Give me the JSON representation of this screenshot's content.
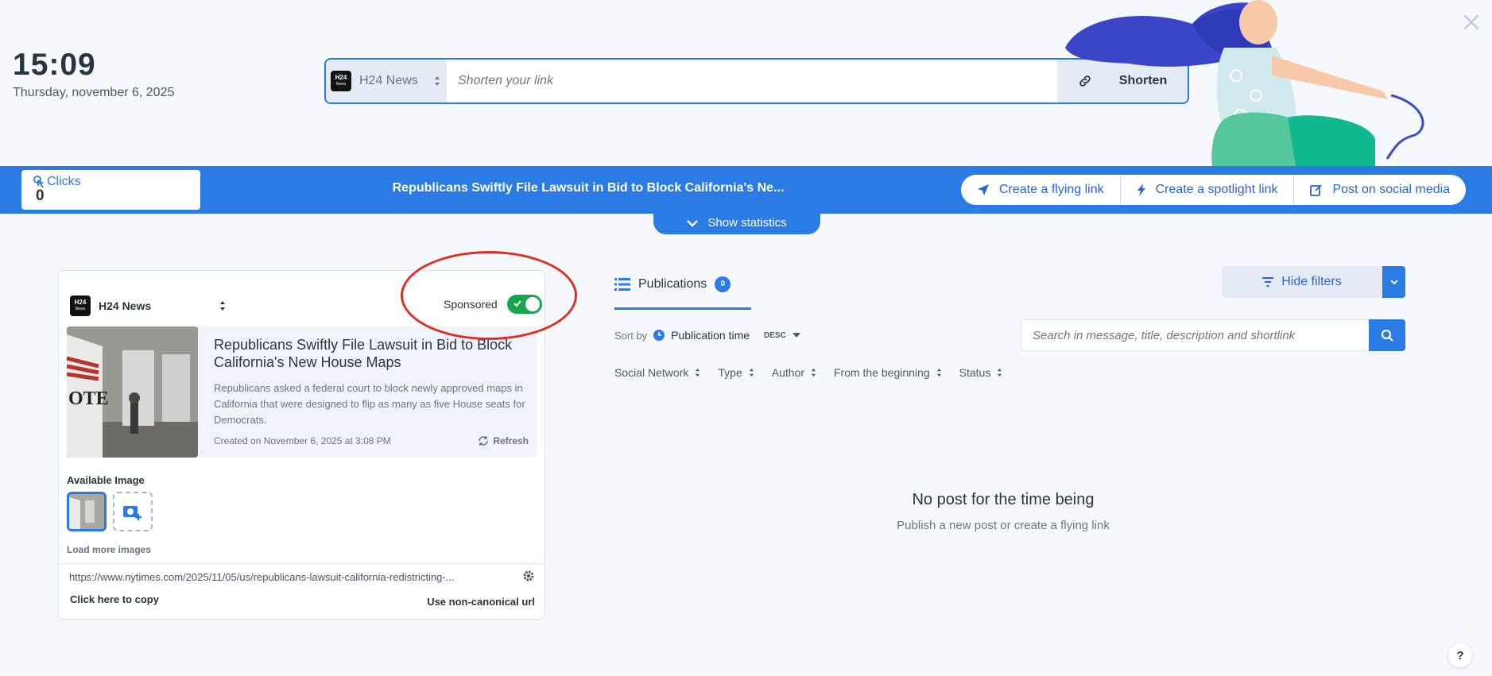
{
  "clock": {
    "time": "15:09",
    "date": "Thursday, november 6, 2025"
  },
  "shortener": {
    "brand": "H24 News",
    "placeholder": "Shorten your link",
    "button": "Shorten"
  },
  "logo": {
    "top": "H24",
    "bottom": "News"
  },
  "bar": {
    "clicks_label": "Clicks",
    "clicks_value": "0",
    "title": "Republicans Swiftly File Lawsuit in Bid to Block California's Ne...",
    "actions": [
      "Create a flying link",
      "Create a spotlight link",
      "Post on social media"
    ],
    "stats_label": "Show statistics"
  },
  "card": {
    "brand": "H24 News",
    "sponsored_label": "Sponsored",
    "sponsored_on": true,
    "preview_title": "Republicans Swiftly File Lawsuit in Bid to Block California's New House Maps",
    "preview_desc": "Republicans asked a federal court to block newly approved maps in California that were designed to flip as many as five House seats for Democrats.",
    "created": "Created on November 6, 2025 at 3:08 PM",
    "refresh": "Refresh",
    "available_image": "Available Image",
    "load_more": "Load more images",
    "url": "https://www.nytimes.com/2025/11/05/us/republicans-lawsuit-california-redistricting-...",
    "copy": "Click here to copy",
    "non_canonical": "Use non-canonical url",
    "thumb_text": "OTE"
  },
  "publications": {
    "tab_label": "Publications",
    "count": "0",
    "hide_filters": "Hide filters",
    "sort_by": "Sort by",
    "sort_field": "Publication time",
    "sort_dir": "DESC",
    "search_placeholder": "Search in message, title, description and shortlink",
    "filters": [
      "Social Network",
      "Type",
      "Author",
      "From the beginning",
      "Status"
    ],
    "empty_title": "No post for the time being",
    "empty_sub": "Publish a new post or create a flying link"
  },
  "help": "?",
  "colors": {
    "accent": "#2a7be4",
    "toggle_on": "#19a54c",
    "annotation": "#e02d24"
  }
}
